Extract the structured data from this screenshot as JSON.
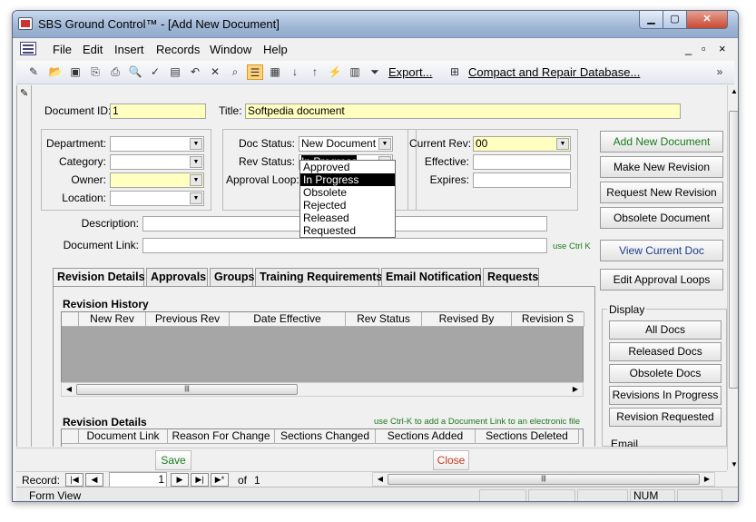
{
  "window": {
    "title": "SBS Ground Control™ - [Add New Document]"
  },
  "menu": {
    "items": [
      "File",
      "Edit",
      "Insert",
      "Records",
      "Window",
      "Help"
    ],
    "mdi_controls": [
      "_",
      "▫",
      "×"
    ]
  },
  "toolbar": {
    "export_label": "Export...",
    "compact_label": "Compact and Repair Database..."
  },
  "form": {
    "document_id_label": "Document ID:",
    "document_id_value": "1",
    "title_label": "Title:",
    "title_value": "Softpedia document",
    "department_label": "Department:",
    "category_label": "Category:",
    "owner_label": "Owner:",
    "location_label": "Location:",
    "doc_status_label": "Doc Status:",
    "doc_status_value": "New Document",
    "rev_status_label": "Rev Status:",
    "rev_status_value": "In Progress",
    "approval_loop_label": "Approval Loop:",
    "current_rev_label": "Current Rev:",
    "current_rev_value": "00",
    "effective_label": "Effective:",
    "expires_label": "Expires:",
    "description_label": "Description:",
    "document_link_label": "Document Link:",
    "ctrlk_hint": "use Ctrl K"
  },
  "rev_status_options": [
    "Approved",
    "In Progress",
    "Obsolete",
    "Rejected",
    "Released",
    "Requested"
  ],
  "actions": [
    "Add New Document",
    "Make New Revision",
    "Request New Revision",
    "Obsolete Document",
    "View Current Doc",
    "Edit Approval Loops"
  ],
  "display": {
    "label": "Display",
    "buttons": [
      "All Docs",
      "Released Docs",
      "Obsolete Docs",
      "Revisions In Progress",
      "Revision Requested"
    ],
    "email_label": "Email"
  },
  "tabs": [
    "Revision Details",
    "Approvals",
    "Groups",
    "Training Requirements",
    "Email Notification",
    "Requests"
  ],
  "revision_history": {
    "title": "Revision History",
    "columns": [
      "New Rev",
      "Previous Rev",
      "Date Effective",
      "Rev Status",
      "Revised By",
      "Revision S"
    ]
  },
  "revision_details": {
    "title": "Revision Details",
    "hint": "use Ctrl-K to add a Document Link to an electronic file",
    "columns": [
      "Document Link",
      "Reason For Change",
      "Sections Changed",
      "Sections Added",
      "Sections Deleted"
    ]
  },
  "footer": {
    "save_label": "Save",
    "close_label": "Close"
  },
  "record_nav": {
    "label": "Record:",
    "current": "1",
    "of_label": "of",
    "total": "1"
  },
  "status": {
    "mode": "Form View",
    "num": "NUM"
  }
}
